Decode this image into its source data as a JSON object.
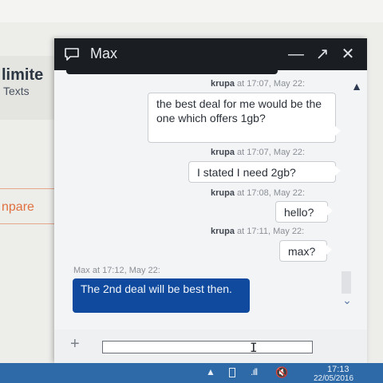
{
  "background": {
    "title": "limite",
    "subtitle": "Texts",
    "compare": "npare"
  },
  "chat": {
    "title": "Max",
    "header_buttons": {
      "minimize": "—",
      "expand": "↗",
      "close": "✕"
    },
    "messages": [
      {
        "sender": "krupa",
        "meta": "at 17:07, May 22:",
        "text": "the best deal for me would be the one which offers 1gb?"
      },
      {
        "sender": "krupa",
        "meta": "at 17:07, May 22:",
        "text": "I stated I need 2gb?"
      },
      {
        "sender": "krupa",
        "meta": "at 17:08, May 22:",
        "text": "hello?"
      },
      {
        "sender": "krupa",
        "meta": "at 17:11, May 22:",
        "text": "max?"
      },
      {
        "sender": "Max",
        "meta": "at 17:12, May 22:",
        "text": "The 2nd deal will be best then."
      }
    ],
    "composer": {
      "plus": "+",
      "input_value": ""
    }
  },
  "taskbar": {
    "time": "17:13",
    "date": "22/05/2016",
    "icons": [
      "show-hidden-icons",
      "battery-icon",
      "signal-icon",
      "volume-icon"
    ]
  },
  "colors": {
    "header": "#1a1d22",
    "agent_bubble": "#0f4a9e",
    "taskbar": "#2e6aa8",
    "accent_orange": "#e0703f"
  }
}
